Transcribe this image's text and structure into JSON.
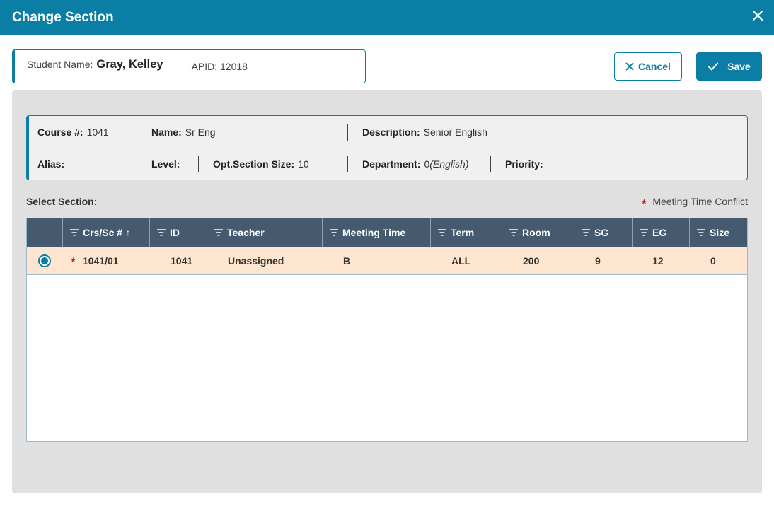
{
  "dialog": {
    "title": "Change Section"
  },
  "student": {
    "name_label": "Student Name:",
    "name_value": "Gray, Kelley",
    "apid": "APID: 12018"
  },
  "actions": {
    "cancel_label": "Cancel",
    "save_label": "Save"
  },
  "course": {
    "course_no_label": "Course #:",
    "course_no": "1041",
    "name_label": "Name:",
    "name": "Sr Eng",
    "description_label": "Description:",
    "description": "Senior English",
    "alias_label": "Alias:",
    "alias": "",
    "level_label": "Level:",
    "level": "",
    "opt_size_label": "Opt.Section Size:",
    "opt_size": "10",
    "department_label": "Department:",
    "department_code": "0",
    "department_name": "(English)",
    "priority_label": "Priority:",
    "priority": ""
  },
  "sections": {
    "select_label": "Select Section:",
    "conflict_legend": "Meeting Time Conflict",
    "columns": [
      "Crs/Sc #",
      "ID",
      "Teacher",
      "Meeting Time",
      "Term",
      "Room",
      "SG",
      "EG",
      "Size"
    ],
    "sort_column": "Crs/Sc #",
    "sort_direction": "ascending",
    "rows": [
      {
        "selected": true,
        "conflict": true,
        "crs_sc": "1041/01",
        "id": "1041",
        "teacher": "Unassigned",
        "meeting_time": "B",
        "term": "ALL",
        "room": "200",
        "sg": "9",
        "eg": "12",
        "size": "0"
      }
    ]
  },
  "colors": {
    "accent": "#0a7ea4",
    "header_bg": "#455a6e",
    "row_highlight": "#fde5cf",
    "conflict": "#d42020"
  }
}
